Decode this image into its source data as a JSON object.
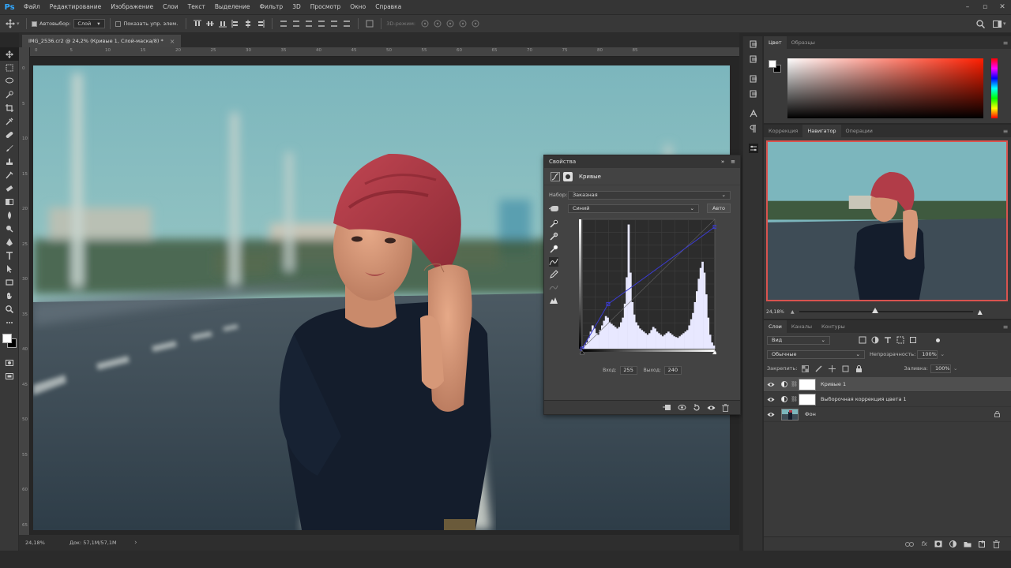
{
  "app": {
    "logo": "Ps"
  },
  "menu": [
    "Файл",
    "Редактирование",
    "Изображение",
    "Слои",
    "Текст",
    "Выделение",
    "Фильтр",
    "3D",
    "Просмотр",
    "Окно",
    "Справка"
  ],
  "window_controls": [
    "–",
    "▫",
    "✕"
  ],
  "options": {
    "autoselect_label": "Автовыбор:",
    "autoselect_value": "Слой",
    "show_controls_label": "Показать упр. элем.",
    "mode3d_label": "3D-режим:"
  },
  "document": {
    "tab_title": "IMG_2536.cr2 @ 24,2% (Кривые 1, Слой-маска/8) *",
    "close": "×"
  },
  "ruler": {
    "top": [
      "0",
      "5",
      "10",
      "15",
      "20",
      "25",
      "30",
      "35",
      "40",
      "45",
      "50",
      "55",
      "60",
      "65",
      "70",
      "75",
      "80",
      "85"
    ],
    "left": [
      "0",
      "5",
      "10",
      "15",
      "20",
      "25",
      "30",
      "35",
      "40",
      "45",
      "50",
      "55",
      "60",
      "65"
    ]
  },
  "status": {
    "zoom": "24,18%",
    "doc": "Док: 57,1M/57,1M",
    "arrow": "›"
  },
  "properties": {
    "title": "Свойства",
    "collapse": "»",
    "menu": "≡",
    "type_label": "Кривые",
    "preset_label": "Набор:",
    "preset_value": "Заказная",
    "channel_value": "Синий",
    "auto_button": "Авто",
    "input_label": "Вход:",
    "input_value": "255",
    "output_label": "Выход:",
    "output_value": "240"
  },
  "histogram": {
    "channel_color": "#e8e8ff",
    "curve_color": "#3b3bd0",
    "bins": [
      3,
      5,
      8,
      14,
      22,
      30,
      26,
      20,
      18,
      24,
      30,
      36,
      42,
      40,
      34,
      32,
      30,
      28,
      26,
      28,
      34,
      40,
      58,
      92,
      160,
      98,
      60,
      44,
      34,
      30,
      26,
      24,
      22,
      20,
      18,
      20,
      24,
      28,
      26,
      22,
      20,
      18,
      16,
      18,
      20,
      22,
      20,
      18,
      16,
      15,
      14,
      16,
      18,
      20,
      22,
      24,
      30,
      38,
      46,
      60,
      74,
      90,
      104,
      112,
      98,
      70,
      40,
      18,
      8,
      4
    ],
    "curve": [
      [
        0,
        0
      ],
      [
        50,
        88
      ],
      [
        255,
        240
      ]
    ]
  },
  "color_panel": {
    "tabs": [
      "Цвет",
      "Образцы"
    ],
    "fg": "#ffffff",
    "bg": "#000000",
    "hue": "#ff1e00"
  },
  "navigator": {
    "tabs": [
      "Коррекция",
      "Навигатор",
      "Операции"
    ],
    "zoom": "24,18%",
    "zoom_level": 0.44
  },
  "layers_panel": {
    "tabs": [
      "Слои",
      "Каналы",
      "Контуры"
    ],
    "kind_value": "Вид",
    "blend_value": "Обычные",
    "opacity_label": "Непрозрачность:",
    "opacity_value": "100%",
    "lock_label": "Закрепить:",
    "fill_label": "Заливка:",
    "fill_value": "100%",
    "layers": [
      {
        "name": "Кривые 1",
        "selected": true,
        "type": "adjustment"
      },
      {
        "name": "Выборочная коррекция цвета 1",
        "selected": false,
        "type": "adjustment"
      },
      {
        "name": "Фон",
        "selected": false,
        "type": "image",
        "locked": true
      }
    ]
  }
}
